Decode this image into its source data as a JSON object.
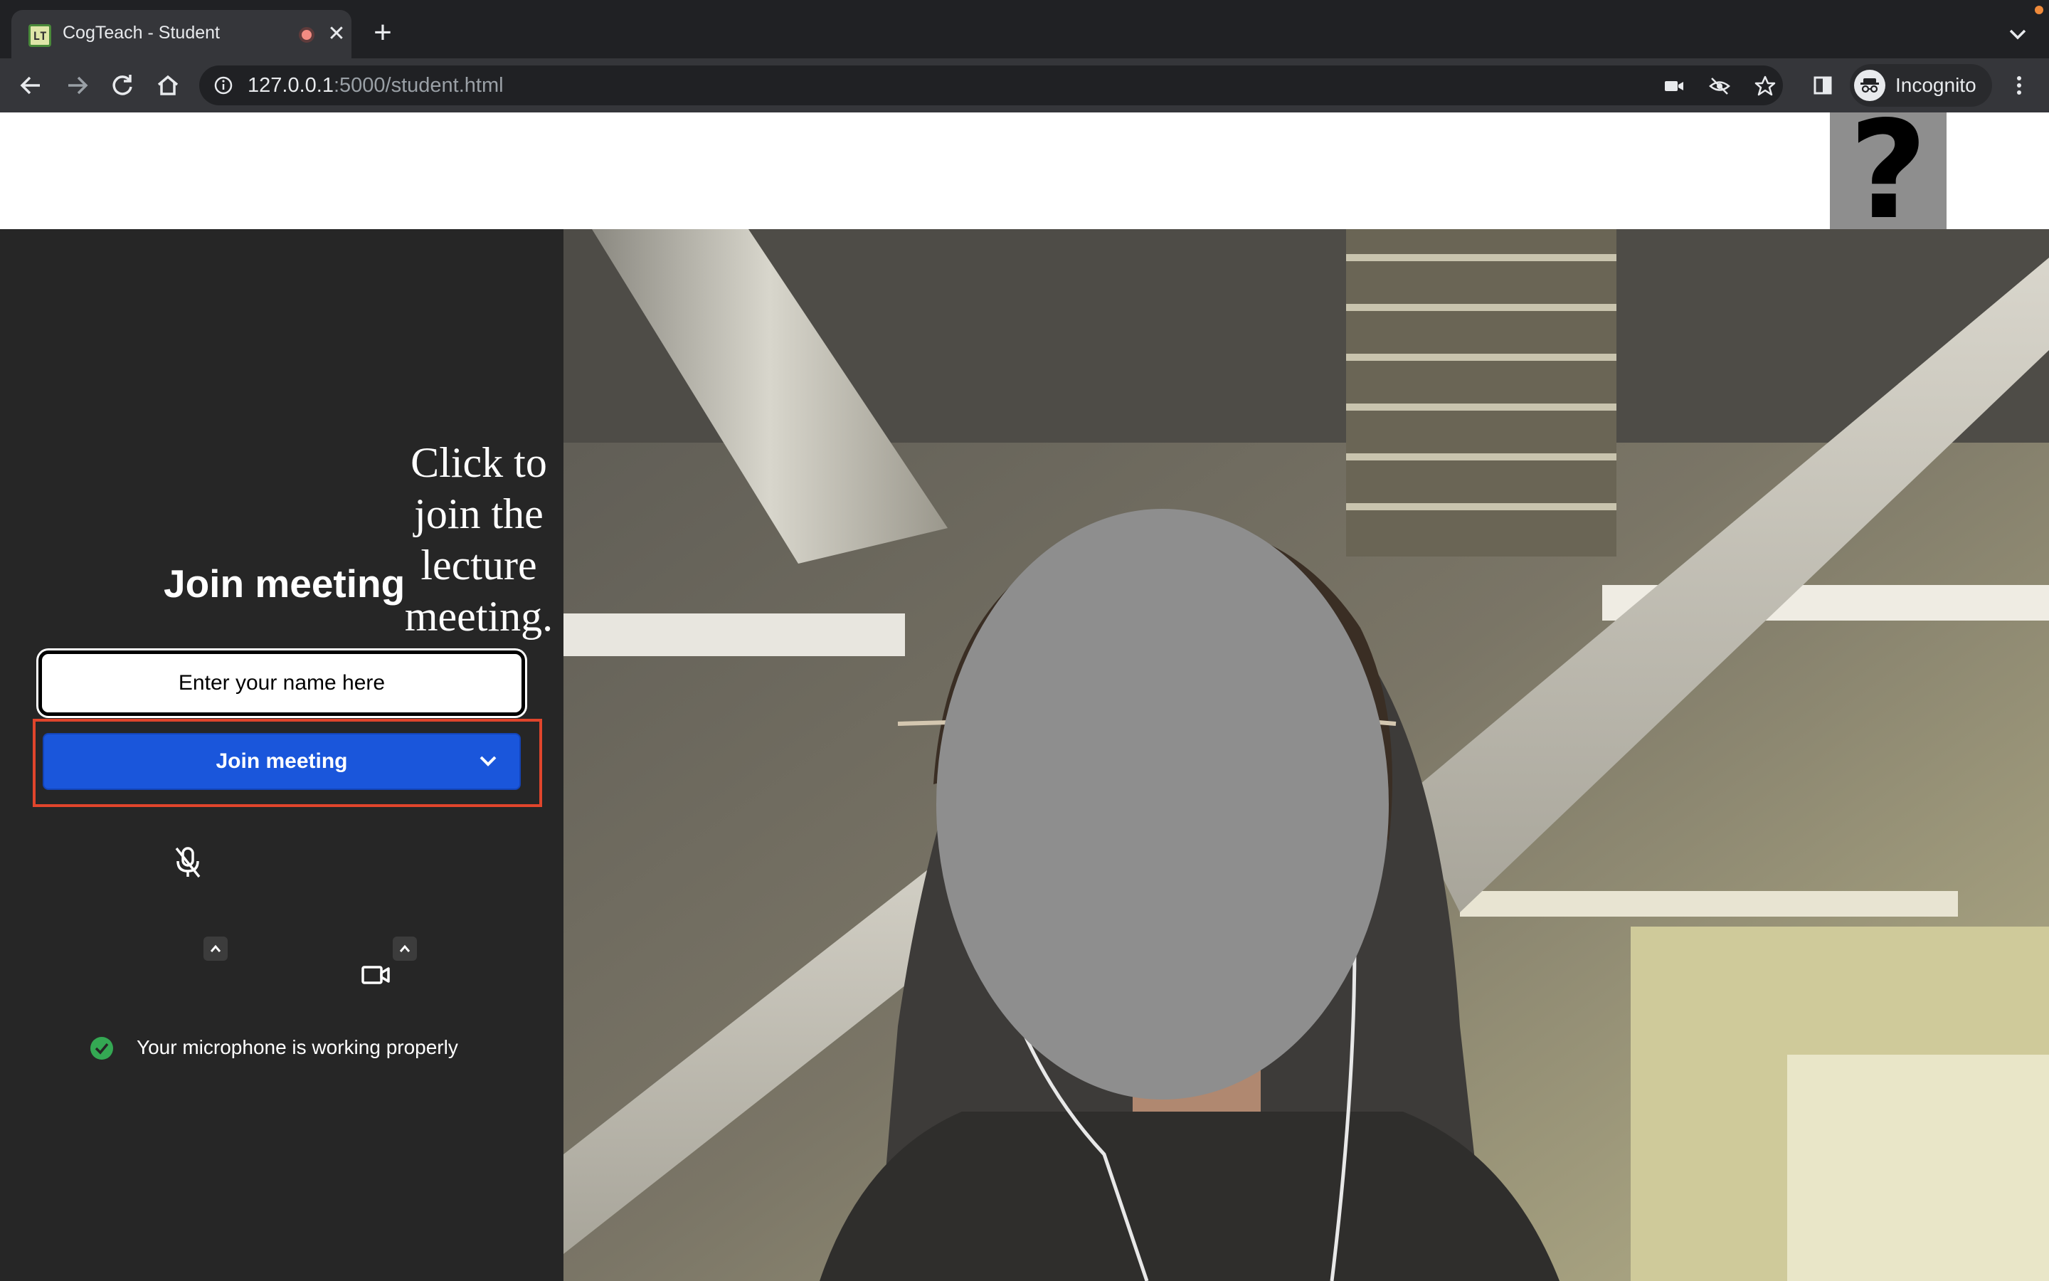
{
  "browser": {
    "tab": {
      "title": "CogTeach - Student",
      "favicon_text": "LT",
      "recording": true
    },
    "url": {
      "host": "127.0.0.1",
      "path": ":5000/student.html"
    },
    "profile_label": "Incognito",
    "icons": [
      "back-icon",
      "forward-icon",
      "reload-icon",
      "home-icon",
      "info-icon",
      "camera-icon",
      "eye-off-icon",
      "star-icon",
      "side-panel-icon",
      "incognito-icon",
      "more-icon"
    ]
  },
  "page": {
    "help_symbol": "?",
    "join": {
      "title": "Join meeting",
      "tooltip": "Click to join the lecture meeting.",
      "name_placeholder": "Enter your name here",
      "button_label": "Join meeting"
    },
    "status": {
      "message": "Your microphone is working properly",
      "color": "#34a853"
    },
    "colors": {
      "accent": "#1a56db",
      "highlight": "#e0452c",
      "panel": "#262626"
    }
  }
}
